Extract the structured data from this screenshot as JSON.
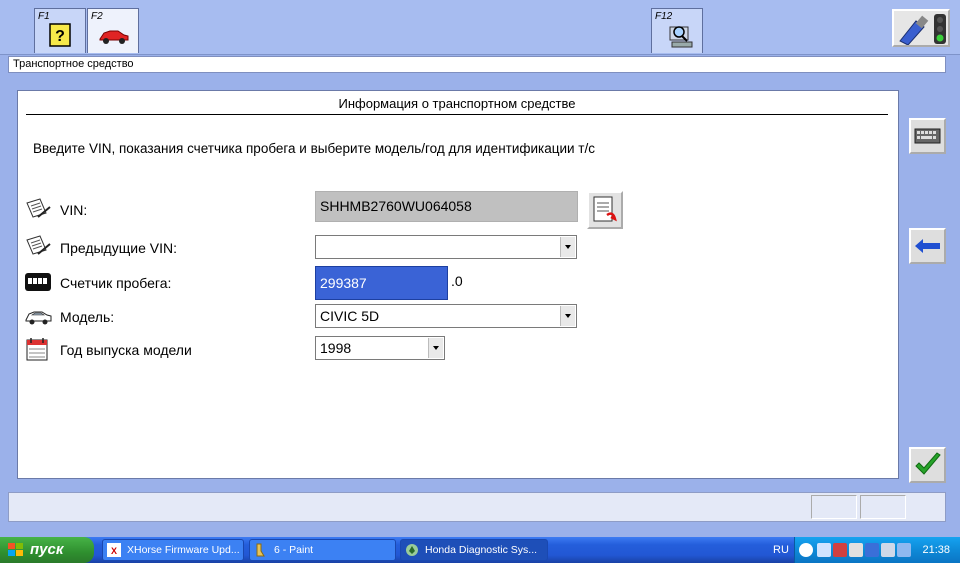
{
  "toolbar": {
    "tabs": [
      {
        "key": "F1",
        "icon": "help-icon"
      },
      {
        "key": "F2",
        "icon": "car-icon"
      },
      {
        "key": "F12",
        "icon": "search-computer-icon"
      }
    ],
    "connection_icon": "connector-traffic-light-icon"
  },
  "window": {
    "screen_title": "Транспортное средство"
  },
  "main": {
    "section_title": "Информация о транспортном средстве",
    "instruction": "Введите VIN, показания счетчика пробега и выберите модель/год для идентификации т/с",
    "fields": {
      "vin": {
        "label": "VIN:",
        "value": "SHHMB2760WU064058"
      },
      "prev_vin": {
        "label": "Предыдущие VIN:",
        "value": ""
      },
      "odometer": {
        "label": "Счетчик пробега:",
        "value": "299387",
        "suffix": ".0"
      },
      "model": {
        "label": "Модель:",
        "value": "CIVIC 5D"
      },
      "year": {
        "label": "Год выпуска модели",
        "value": "1998"
      }
    }
  },
  "side_buttons": {
    "keyboard_icon": "keyboard-icon",
    "back_icon": "back-arrow-icon",
    "ok_icon": "checkmark-icon"
  },
  "taskbar": {
    "start_label": "пуск",
    "tasks": [
      {
        "label": "XHorse Firmware Upd...",
        "active": false
      },
      {
        "label": "6 - Paint",
        "active": false
      },
      {
        "label": "Honda Diagnostic Sys...",
        "active": true
      }
    ],
    "language": "RU",
    "clock": "21:38"
  },
  "colors": {
    "background": "#9bb1ea",
    "selection": "#3a63d6",
    "taskbar": "#245edb",
    "start": "#2f8f2f"
  }
}
